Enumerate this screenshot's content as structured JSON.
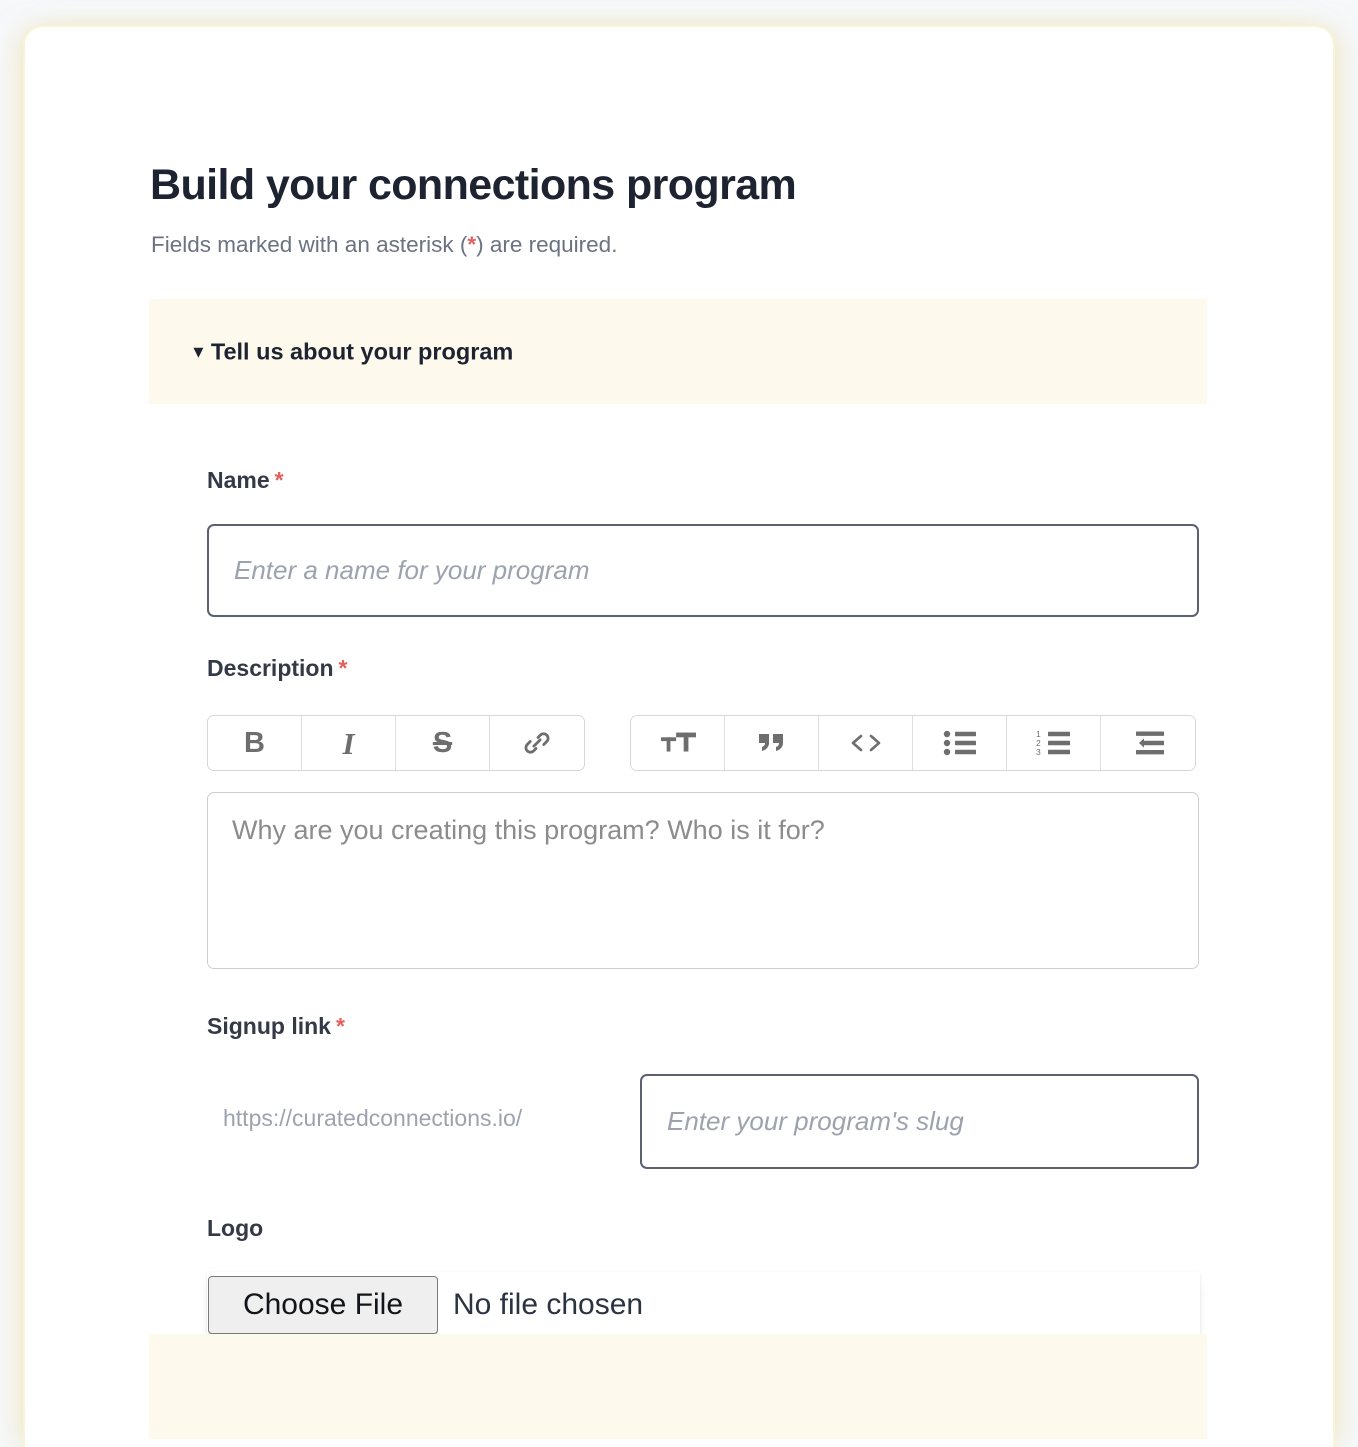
{
  "page": {
    "title": "Build your connections program",
    "required_note_before": "Fields marked with an asterisk (",
    "required_note_asterisk": "*",
    "required_note_after": ") are required.",
    "background_color": "#f6f8fa",
    "card_background": "#ffffff",
    "accent_cream": "#fdf9ec",
    "required_color": "#e2605d",
    "label_color": "#343a45",
    "input_border_color": "#5b6170"
  },
  "sections": [
    {
      "id": "tell-us-about-your-program",
      "disclosure_marker": "▼",
      "title": "Tell us about your program",
      "expanded": true
    },
    {
      "id": "next-section",
      "disclosure_marker": "▼",
      "title": "",
      "expanded": false
    }
  ],
  "fields": {
    "name": {
      "label": "Name",
      "required_marker": "*",
      "value": "",
      "placeholder": "Enter a name for your program"
    },
    "description": {
      "label": "Description",
      "required_marker": "*",
      "value": "",
      "placeholder": "Why are you creating this program? Who is it for?"
    },
    "signup_link": {
      "label": "Signup link",
      "required_marker": "*",
      "prefix": "https://curatedconnections.io/",
      "value": "",
      "placeholder": "Enter your program's slug"
    },
    "logo": {
      "label": "Logo",
      "required_marker": "",
      "button_label": "Choose File",
      "status_text": "No file chosen"
    }
  },
  "editor_toolbar": {
    "group_1": [
      {
        "name": "bold-icon",
        "label": "B",
        "title": "Bold"
      },
      {
        "name": "italic-icon",
        "label": "I",
        "title": "Italic"
      },
      {
        "name": "strikethrough-icon",
        "label": "S",
        "title": "Strikethrough"
      },
      {
        "name": "link-icon",
        "label": "",
        "title": "Link"
      }
    ],
    "group_2": [
      {
        "name": "text-size-icon",
        "label": "tT",
        "title": "Text size"
      },
      {
        "name": "blockquote-icon",
        "label": "”",
        "title": "Quote"
      },
      {
        "name": "code-icon",
        "label": "< >",
        "title": "Code"
      },
      {
        "name": "bullet-list-icon",
        "label": "",
        "title": "Bulleted list"
      },
      {
        "name": "numbered-list-icon",
        "label": "",
        "title": "Numbered list"
      },
      {
        "name": "outdent-icon",
        "label": "",
        "title": "Decrease indent"
      }
    ]
  }
}
